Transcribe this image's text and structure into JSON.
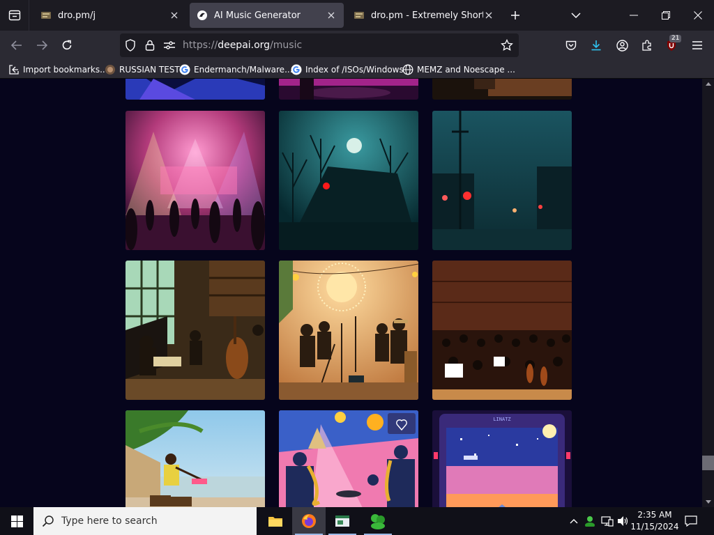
{
  "browser": {
    "tabs": [
      {
        "title": "dro.pm/j",
        "active": false
      },
      {
        "title": "AI Music Generator",
        "active": true
      },
      {
        "title": "dro.pm - Extremely Short Links",
        "active": false
      }
    ],
    "url": {
      "scheme": "https://",
      "host": "deepai.org",
      "path": "/music"
    },
    "extensions_badge": "21",
    "bookmarks": [
      {
        "label": "Import bookmarks...",
        "icon": "import-icon"
      },
      {
        "label": "RUSSIAN TEST",
        "icon": "site-favicon"
      },
      {
        "label": "Endermanch/Malware...",
        "icon": "google-icon"
      },
      {
        "label": "Index of /ISOs/Windows",
        "icon": "google-icon"
      },
      {
        "label": "MEMZ and Noescape ...",
        "icon": "globe-icon"
      }
    ]
  },
  "gallery": {
    "images": [
      {
        "scene": "stage-concert-lights"
      },
      {
        "scene": "dark-forest-house-red-eyes"
      },
      {
        "scene": "foggy-street-red-lights"
      },
      {
        "scene": "jazz-band-library-sunlight"
      },
      {
        "scene": "musicians-string-lights"
      },
      {
        "scene": "orchestra-hall"
      },
      {
        "scene": "beach-flute-player"
      },
      {
        "scene": "saxophone-retro-poster"
      },
      {
        "scene": "pixel-art-arcade"
      }
    ],
    "favorite_icon": "heart-icon",
    "arcade_label": "LINATZ"
  },
  "taskbar": {
    "search_placeholder": "Type here to search",
    "time": "2:35 AM",
    "date": "11/15/2024"
  },
  "colors": {
    "tab_bg": "#1c1b22",
    "toolbar_bg": "#2b2a33",
    "active_tab": "#42414d",
    "page_bg": "#06051c"
  }
}
